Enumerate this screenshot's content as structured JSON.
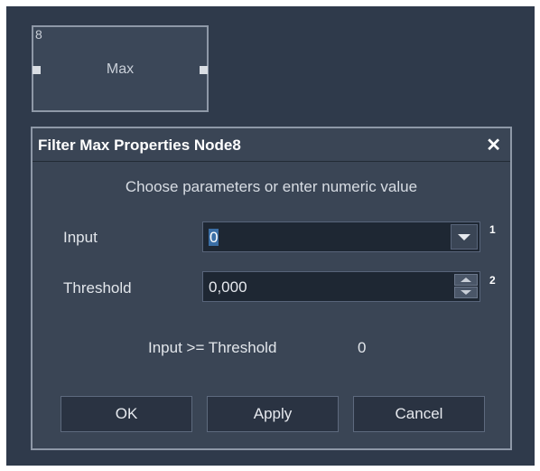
{
  "node": {
    "id": "8",
    "label": "Max"
  },
  "dialog": {
    "title": "Filter Max Properties Node8",
    "close_label": "✕",
    "hint": "Choose parameters or enter numeric value",
    "input": {
      "label": "Input",
      "value": "0",
      "number": "1"
    },
    "threshold": {
      "label": "Threshold",
      "value": "0,000",
      "number": "2"
    },
    "expression": {
      "text": "Input >= Threshold",
      "value": "0"
    },
    "buttons": {
      "ok": "OK",
      "apply": "Apply",
      "cancel": "Cancel"
    }
  },
  "icons": {
    "close": "close-icon",
    "dropdown": "chevron-down-icon",
    "spin_up": "arrow-up-icon",
    "spin_down": "arrow-down-icon"
  },
  "colors": {
    "background": "#2f3a4b",
    "panel": "#3a4555",
    "field": "#1e2733",
    "border": "#8e98a7",
    "text": "#e2e6eb",
    "selection": "#3a6ea5"
  }
}
